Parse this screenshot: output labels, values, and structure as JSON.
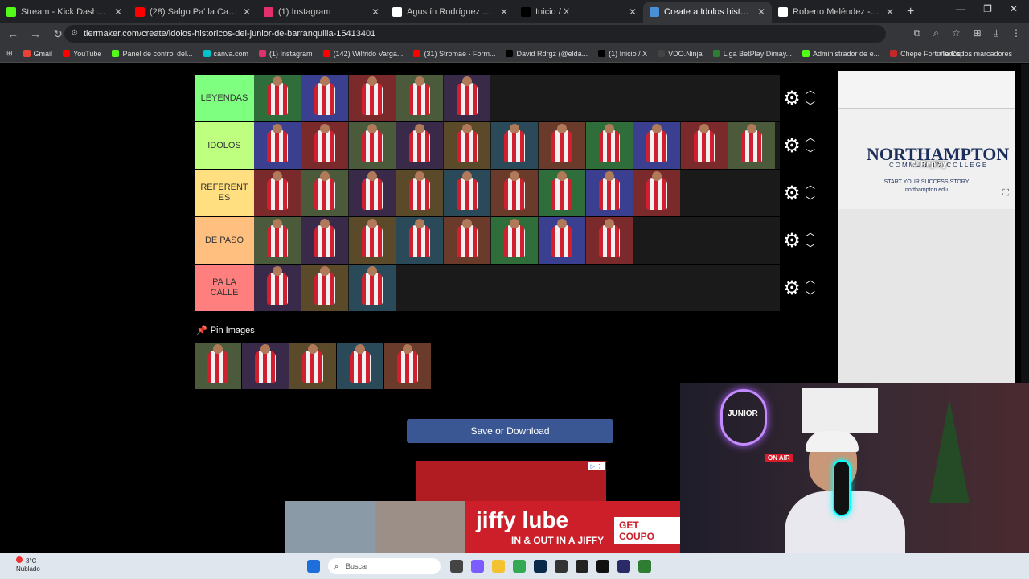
{
  "browser": {
    "tabs": [
      {
        "title": "Stream - Kick Dashboard",
        "color": "#53fc18",
        "active": false
      },
      {
        "title": "(28) Salgo Pa' la Calle - YouTub",
        "color": "#ff0000",
        "active": false
      },
      {
        "title": "(1) Instagram",
        "color": "#e1306c",
        "active": false
      },
      {
        "title": "Agustín Rodríguez Rosano - W",
        "color": "#ffffff",
        "active": false
      },
      {
        "title": "Inicio / X",
        "color": "#000000",
        "active": false
      },
      {
        "title": "Create a Idolos historicos del ju",
        "color": "#4a90d9",
        "active": true
      },
      {
        "title": "Roberto Meléndez - Wikipedia,",
        "color": "#ffffff",
        "active": false
      }
    ],
    "url": "tiermaker.com/create/idolos-historicos-del-junior-de-barranquilla-15413401",
    "bookmarks": [
      {
        "label": "Gmail",
        "color": "#ea4335"
      },
      {
        "label": "YouTube",
        "color": "#ff0000"
      },
      {
        "label": "Panel de control del...",
        "color": "#53fc18"
      },
      {
        "label": "canva.com",
        "color": "#00c4cc"
      },
      {
        "label": "(1) Instagram",
        "color": "#e1306c"
      },
      {
        "label": "(142) Wilfrido Varga...",
        "color": "#ff0000"
      },
      {
        "label": "(31) Stromae - Form...",
        "color": "#ff0000"
      },
      {
        "label": "David Rdrgz (@elda...",
        "color": "#000000"
      },
      {
        "label": "(1) Inicio / X",
        "color": "#000000"
      },
      {
        "label": "VDO.Ninja",
        "color": "#444444"
      },
      {
        "label": "Liga BetPlay Dimay...",
        "color": "#2e7d32"
      },
      {
        "label": "Administrador de e...",
        "color": "#53fc18"
      },
      {
        "label": "Chepe Fortuna Capí...",
        "color": "#c62828"
      }
    ],
    "bookmarks_all": "Todos los marcadores"
  },
  "tiers": [
    {
      "label": "LEYENDAS",
      "color": "#7fff7f",
      "count": 5
    },
    {
      "label": "IDOLOS",
      "color": "#bfff7f",
      "count": 11
    },
    {
      "label": "REFERENT ES",
      "color": "#ffdf7f",
      "count": 9
    },
    {
      "label": "DE PASO",
      "color": "#ffbf7f",
      "count": 8
    },
    {
      "label": "PA LA CALLE",
      "color": "#ff7f7f",
      "count": 3
    }
  ],
  "pin_label": "Pin Images",
  "pool_count": 5,
  "save_button": "Save or Download",
  "side_ad": {
    "name": "NORTHAMPTON",
    "sub": "COMMUNITY COLLEGE",
    "story": "START YOUR SUCCESS STORY",
    "url": "northampton.edu",
    "replay": "Replay"
  },
  "stream": {
    "neon": "JUNIOR",
    "onair": "ON AIR"
  },
  "bottom_ad": {
    "brand": "jiffy lube",
    "tagline": "IN & OUT IN A JIFFY",
    "cta": "GET COUPO"
  },
  "taskbar": {
    "temp": "3°C",
    "weather": "Nublado",
    "search": "Buscar"
  }
}
